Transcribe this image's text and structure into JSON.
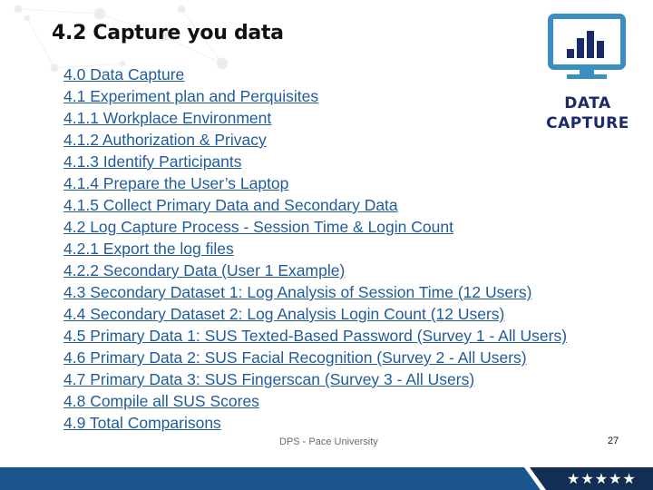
{
  "slide": {
    "title": "4.2 Capture you data",
    "toc": [
      "4.0 Data Capture",
      "4.1 Experiment plan and Perquisites",
      "4.1.1 Workplace Environment",
      "4.1.2 Authorization & Privacy",
      "4.1.3 Identify Participants",
      "4.1.4 Prepare the User’s Laptop",
      "4.1.5 Collect Primary Data and Secondary Data",
      "4.2 Log Capture Process - Session Time & Login Count",
      "4.2.1 Export the log files",
      "4.2.2 Secondary Data (User 1 Example)",
      "4.3 Secondary Dataset 1: Log Analysis of Session Time (12 Users)",
      "4.4 Secondary Dataset 2: Log Analysis Login Count (12 Users)",
      "4.5 Primary Data 1: SUS Texted-Based Password (Survey 1 - All Users)",
      "4.6 Primary Data 2: SUS Facial Recognition (Survey 2 - All Users)",
      "4.7 Primary Data 3: SUS Fingerscan (Survey 3 - All Users)",
      "4.8 Compile all SUS Scores",
      "4.9 Total Comparisons"
    ],
    "logo": {
      "icon": "monitor-bar-chart-icon",
      "line1": "DATA",
      "line2": "CAPTURE"
    },
    "footer": {
      "text": "DPS - Pace University",
      "page_number": "27",
      "stars": "★★★★★"
    }
  },
  "colors": {
    "link": "#1f5c99",
    "bar_blue": "#1b5590",
    "bar_navy": "#132e55",
    "logo_navy": "#1b2a6b",
    "logo_frame": "#3a8fc0"
  }
}
